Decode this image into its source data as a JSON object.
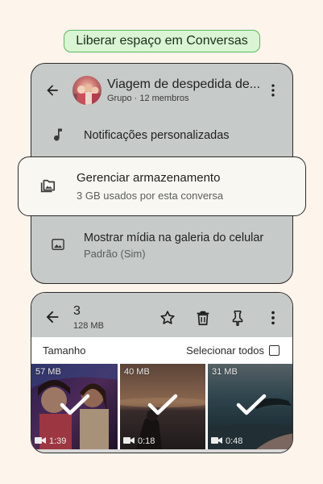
{
  "banner": {
    "text": "Liberar espaço em Conversas"
  },
  "chat_info": {
    "title": "Viagem de despedida de...",
    "subtitle": "Grupo · 12 membros",
    "rows": [
      {
        "title": "Notificações personalizadas",
        "subtitle": "",
        "icon": "music-note-icon"
      },
      {
        "title": "Gerenciar armazenamento",
        "subtitle": "3 GB usados por esta conversa",
        "icon": "folder-image-icon"
      },
      {
        "title": "Mostrar mídia na galeria do celular",
        "subtitle": "Padrão (Sim)",
        "icon": "image-icon"
      }
    ]
  },
  "selection": {
    "count": "3",
    "size": "128 MB",
    "actions": [
      "star-icon",
      "trash-icon",
      "pin-icon",
      "more-vert-icon"
    ],
    "filter_label": "Tamanho",
    "select_all_label": "Selecionar todos",
    "media": [
      {
        "size": "57 MB",
        "duration": "1:39",
        "selected": true
      },
      {
        "size": "40 MB",
        "duration": "0:18",
        "selected": true
      },
      {
        "size": "31 MB",
        "duration": "0:48",
        "selected": true
      }
    ]
  },
  "colors": {
    "background": "#fdf4ec",
    "banner_bg": "#d9f5d4",
    "banner_border": "#59b85c",
    "card_bg": "#c6cac8",
    "popup_bg": "#f9f7f2"
  }
}
